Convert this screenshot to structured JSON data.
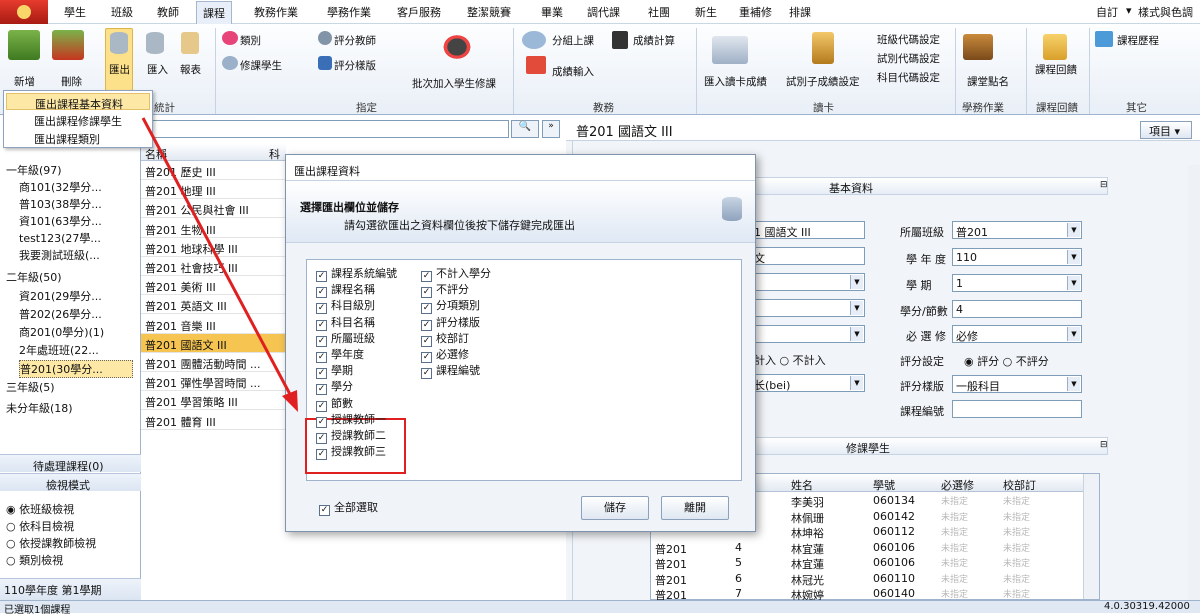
{
  "tabs": [
    "學生",
    "班級",
    "教師",
    "課程",
    "教務作業",
    "學務作業",
    "客戶服務",
    "整潔競賽",
    "畢業",
    "調代課",
    "社團",
    "新生",
    "重補修",
    "排課"
  ],
  "tabs_right": [
    "自訂",
    "▾",
    "樣式與色調"
  ],
  "ribbon": {
    "add": "新增",
    "delete": "刪除",
    "export": "匯出",
    "import": "匯入",
    "report": "報表",
    "category": "類別",
    "edit_student": "修課學生",
    "score_teacher": "評分教師",
    "score_style": "評分樣版",
    "batch_add": "批次加入學生修課",
    "group_class": "分組上課",
    "score_input": "成績輸入",
    "score_calc": "成績計算",
    "import_card": "匯入讀卡成績",
    "exam_setting": "試別子成績設定",
    "set1": "班級代碼設定",
    "set2": "試別代碼設定",
    "set3": "科目代碼設定",
    "roll_call": "課堂點名",
    "feedback": "課程回饋",
    "history": "課程歷程",
    "groups": [
      "統計",
      "指定",
      "教務",
      "讀卡",
      "學務作業",
      "課程回饋",
      "其它"
    ]
  },
  "menu": [
    "匯出課程基本資料",
    "匯出課程修課學生",
    "匯出課程類別"
  ],
  "left": {
    "tree": [
      "一年級(97)",
      "商101(32學分...",
      "普103(38學分...",
      "資101(63學分...",
      "test123(27學...",
      "我要測試班級(...",
      "二年級(50)",
      "資201(29學分...",
      "普202(26學分...",
      "商201(0學分)(1)",
      "2年處班班(22...",
      "普201(30學分...",
      "三年級(5)",
      "未分年級(18)"
    ],
    "pending": "待處理課程(0)",
    "view_mode": "檢視模式",
    "views": [
      "依班級檢視",
      "依科目檢視",
      "依授課教師檢視",
      "類別檢視"
    ],
    "year": "110學年度 第1學期"
  },
  "mid": {
    "col1": "名稱",
    "col2": "科",
    "rows": [
      [
        "普201 歷史 III",
        "歷"
      ],
      [
        "普201 地理 III",
        "地"
      ],
      [
        "普201 公民與社會 III",
        "公"
      ],
      [
        "普201 生物 III",
        "生"
      ],
      [
        "普201 地球科學 III",
        "地"
      ],
      [
        "普201 社會技巧 III",
        "社"
      ],
      [
        "普201 美術 III",
        "美"
      ],
      [
        "普201 英語文 III",
        "英"
      ],
      [
        "普201 音樂 III",
        "音"
      ],
      [
        "普201 國語文 III",
        "國"
      ],
      [
        "普201 團體活動時間 ...",
        "團"
      ],
      [
        "普201 彈性學習時間 ...",
        "彈"
      ],
      [
        "普201 學習策略 III",
        "學"
      ],
      [
        "普201 體育 III",
        "體"
      ]
    ]
  },
  "right": {
    "title": "普201 國語文 III",
    "item_btn": "項目",
    "basic": "基本資料",
    "course_name": "1 國語文 III",
    "subject": "文",
    "class_label": "所屬班級",
    "class_val": "普201",
    "year_label": "學 年 度",
    "year_val": "110",
    "term_label": "學 期",
    "term_val": "1",
    "credit_label": "學分/節數",
    "credit_val": "4",
    "req_label": "必 選 修",
    "req_val": "必修",
    "count_in": "計入",
    "count_out": "不計入",
    "score_label": "評分設定",
    "score_yes": "評分",
    "score_no": "不評分",
    "teacher_val": "长(bei)",
    "style_label": "評分樣版",
    "style_val": "一般科目",
    "code_label": "課程編號",
    "students": "修課學生",
    "headers": [
      "姓名",
      "學號",
      "必選修",
      "校部訂"
    ],
    "srows": [
      [
        "",
        "",
        "李美羽",
        "060134",
        "未指定",
        "未指定"
      ],
      [
        "",
        "",
        "林佩珊",
        "060142",
        "未指定",
        "未指定"
      ],
      [
        "",
        "",
        "林坤裕",
        "060112",
        "未指定",
        "未指定"
      ],
      [
        "普201",
        "4",
        "林宜蓮",
        "060106",
        "未指定",
        "未指定"
      ],
      [
        "普201",
        "5",
        "林宜蓮",
        "060106",
        "未指定",
        "未指定"
      ],
      [
        "普201",
        "6",
        "林冠光",
        "060110",
        "未指定",
        "未指定"
      ],
      [
        "普201",
        "7",
        "林婉婷",
        "060140",
        "未指定",
        "未指定"
      ]
    ]
  },
  "dialog": {
    "title": "匯出課程資料",
    "heading": "選擇匯出欄位並儲存",
    "sub": "請勾選欲匯出之資料欄位後按下儲存鍵完成匯出",
    "col1": [
      "課程系統編號",
      "課程名稱",
      "科目級別",
      "科目名稱",
      "所屬班級",
      "學年度",
      "學期",
      "學分",
      "節數",
      "授課教師一",
      "授課教師二",
      "授課教師三"
    ],
    "col2": [
      "不計入學分",
      "不評分",
      "分項類別",
      "評分樣版",
      "校部訂",
      "必選修",
      "課程編號"
    ],
    "select_all": "全部選取",
    "save": "儲存",
    "close": "離開"
  },
  "status": {
    "left": "已選取1個課程",
    "right": "4.0.30319.42000"
  },
  "colors": {
    "accent": "#f5c451",
    "highlight_red": "#e02020"
  }
}
